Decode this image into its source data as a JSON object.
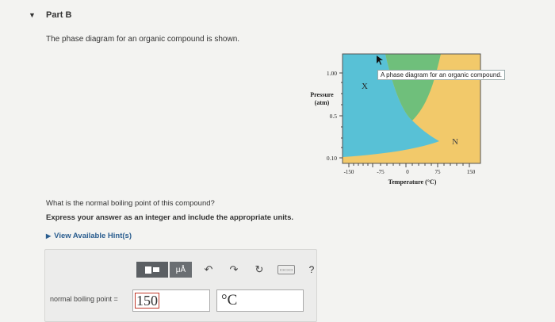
{
  "part": {
    "arrow": "▼",
    "title": "Part B"
  },
  "intro": "The phase diagram for an organic compound is shown.",
  "diagram": {
    "tooltip": "A phase diagram for an organic compound.",
    "y_axis_label_1": "Pressure",
    "y_axis_label_2": "(atm)",
    "y_ticks": [
      "1.00",
      "0.5",
      "0.10"
    ],
    "x_ticks": [
      "-150",
      "-75",
      "0",
      "75",
      "150"
    ],
    "x_axis_label": "Temperature (°C)",
    "point_x": "X",
    "point_n": "N",
    "colors": {
      "solid": "#58c1d6",
      "liquid": "#6fbf7b",
      "gas": "#f2c96a"
    }
  },
  "question": "What is the normal boiling point of this compound?",
  "instruction": "Express your answer as an integer and include the appropriate units.",
  "hints_label": "View Available Hint(s)",
  "toolbar": {
    "units_label": "μÅ",
    "undo_icon": "↶",
    "redo_icon": "↷",
    "reset_icon": "↻",
    "keyboard_label": "▭▭▭",
    "help_label": "?"
  },
  "answer": {
    "label": "normal boiling point =",
    "value": "150",
    "unit": "°C"
  }
}
